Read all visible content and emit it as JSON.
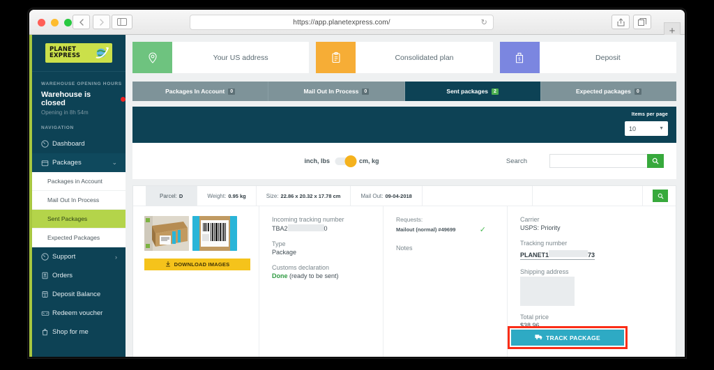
{
  "browser": {
    "url": "https://app.planetexpress.com/",
    "back_icon": "chevron-left-icon",
    "forward_icon": "chevron-right-icon",
    "sidebar_toggle_icon": "sidebar-icon",
    "reload_icon": "reload-icon",
    "share_icon": "share-icon",
    "tabs_icon": "tabs-overview-icon",
    "new_tab_label": "+"
  },
  "sidebar": {
    "logo_line1": "PLANET",
    "logo_line2": "EXPRESS",
    "logo_icon": "globe-arrow-icon",
    "hours_label": "WAREHOUSE OPENING HOURS",
    "status": "Warehouse is closed",
    "status_color": "#ee2222",
    "opening_in": "Opening in 8h 54m",
    "navigation_label": "NAVIGATION",
    "items": [
      {
        "label": "Dashboard",
        "icon": "gauge-icon",
        "chevron": ""
      },
      {
        "label": "Packages",
        "icon": "box-icon",
        "chevron": "⌄"
      }
    ],
    "sub_items": [
      {
        "label": "Packages in Account",
        "active": false
      },
      {
        "label": "Mail Out In Process",
        "active": false
      },
      {
        "label": "Sent Packages",
        "active": true
      },
      {
        "label": "Expected Packages",
        "active": false
      }
    ],
    "items_bottom": [
      {
        "label": "Support",
        "icon": "lifebuoy-icon",
        "chevron": "›"
      },
      {
        "label": "Orders",
        "icon": "clipboard-list-icon",
        "chevron": ""
      },
      {
        "label": "Deposit Balance",
        "icon": "wallet-icon",
        "chevron": ""
      },
      {
        "label": "Redeem voucher",
        "icon": "ticket-icon",
        "chevron": ""
      },
      {
        "label": "Shop for me",
        "icon": "shopping-bag-icon",
        "chevron": ""
      }
    ]
  },
  "quicknav": [
    {
      "label": "Your US address",
      "icon": "map-pin-icon",
      "color": "#6ec37f"
    },
    {
      "label": "Consolidated plan",
      "icon": "clipboard-icon",
      "color": "#f6ad36"
    },
    {
      "label": "Deposit",
      "icon": "money-bag-icon",
      "color": "#7b86e0"
    }
  ],
  "tabs": [
    {
      "label": "Packages In Account",
      "badge": "0",
      "active": false
    },
    {
      "label": "Mail Out In Process",
      "badge": "0",
      "active": false
    },
    {
      "label": "Sent packages",
      "badge": "2",
      "active": true
    },
    {
      "label": "Expected packages",
      "badge": "0",
      "active": false
    }
  ],
  "toolbar": {
    "items_per_page_label": "Items per page",
    "items_per_page_value": "10",
    "caret_icon": "chevron-down-icon",
    "unit_left": "inch, lbs",
    "unit_right": "cm, kg",
    "toggle_state": "cm, kg",
    "search_label": "Search",
    "search_value": "",
    "search_placeholder": "",
    "search_button_icon": "search-icon"
  },
  "parcel": {
    "header": {
      "parcel_label": "Parcel:",
      "parcel_value": "D",
      "weight_label": "Weight:",
      "weight_value": "0.95 kg",
      "size_label": "Size:",
      "size_value": "22.86 x 20.32 x 17.78 cm",
      "mailout_label": "Mail Out:",
      "mailout_value": "09-04-2018",
      "search_icon": "search-icon"
    },
    "images": {
      "thumb1_alt": "package-photo-box",
      "thumb2_alt": "package-photo-label",
      "download_label": "DOWNLOAD IMAGES",
      "download_icon": "download-icon"
    },
    "info": {
      "incoming_label": "Incoming tracking number",
      "incoming_prefix": "TBA2",
      "incoming_suffix": "0",
      "type_label": "Type",
      "type_value": "Package",
      "customs_label": "Customs declaration",
      "customs_status": "Done",
      "customs_note": "(ready to be sent)"
    },
    "requests": {
      "title": "Requests:",
      "item": "Mailout (normal) #49699",
      "check_icon": "check-icon",
      "notes_label": "Notes"
    },
    "carrier": {
      "carrier_label": "Carrier",
      "carrier_value": "USPS: Priority",
      "tracking_label": "Tracking number",
      "tracking_prefix": "PLANET1",
      "tracking_suffix": "73",
      "address_label": "Shipping address",
      "price_label": "Total price",
      "price_value": "$38.96",
      "track_button": "TRACK PACKAGE",
      "track_button_icon": "truck-icon",
      "highlight_color": "#fa2d17"
    }
  }
}
